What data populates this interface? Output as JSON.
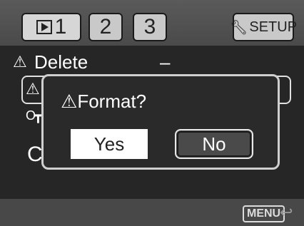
{
  "tabs": [
    {
      "label": "1",
      "active": true,
      "icon": "playback-icon"
    },
    {
      "label": "2",
      "active": false
    },
    {
      "label": "3",
      "active": false
    },
    {
      "label": "SETUP",
      "active": false,
      "icon": "wrench-icon"
    }
  ],
  "menu": {
    "delete_label": "Delete",
    "delete_value": "–",
    "partial_letter": "C"
  },
  "dialog": {
    "title": "Format?",
    "yes_label": "Yes",
    "no_label": "No",
    "selected": "No"
  },
  "footer": {
    "menu_key_label": "MENU"
  },
  "colors": {
    "background": "#262626",
    "topbar": "#555555",
    "tab": "#c9c9c9",
    "dialog_border": "#cfcfcf",
    "selected_button": "#4a4a4a"
  }
}
